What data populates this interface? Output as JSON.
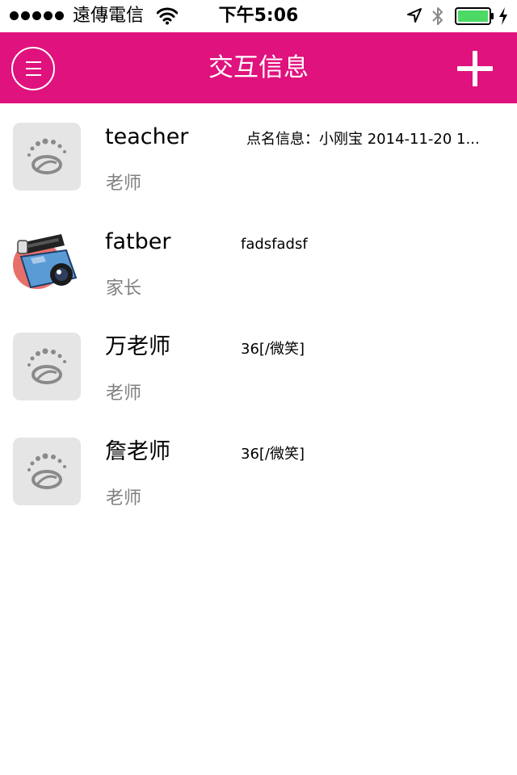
{
  "status_bar": {
    "carrier": "遠傳電信",
    "time": "下午5:06",
    "signal_icon": "signal-dots-icon",
    "wifi_icon": "wifi-icon",
    "location_icon": "location-arrow-icon",
    "bluetooth_icon": "bluetooth-icon",
    "battery_icon": "battery-icon",
    "battery_level": 1.0,
    "charging_icon": "charging-bolt-icon",
    "battery_color": "#4cd964"
  },
  "nav": {
    "title": "交互信息",
    "menu_icon": "menu-icon",
    "add_icon": "plus-icon",
    "background_color": "#e0127d"
  },
  "conversations": [
    {
      "name": "teacher",
      "role": "老师",
      "message": "点名信息：小刚宝 2014-11-20 1...",
      "avatar": "default-avatar-icon"
    },
    {
      "name": "fatber",
      "role": "家长",
      "message": "fadsfadsf",
      "avatar": "camera-avatar-icon"
    },
    {
      "name": "万老师",
      "role": "老师",
      "message": "36[/微笑]",
      "avatar": "default-avatar-icon"
    },
    {
      "name": "詹老师",
      "role": "老师",
      "message": "36[/微笑]",
      "avatar": "default-avatar-icon"
    }
  ]
}
